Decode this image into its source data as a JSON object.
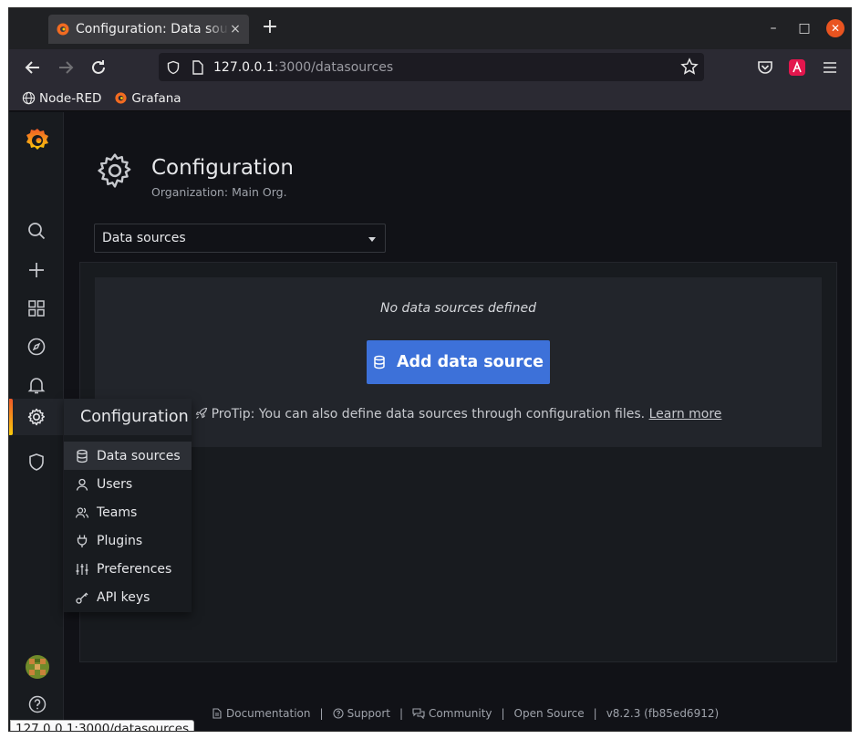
{
  "browser": {
    "tab_title": "Configuration: Data sources",
    "tab_close": "×",
    "new_tab": "+",
    "url_host": "127.0.0.1",
    "url_rest": ":3000/datasources",
    "window_min": "–",
    "window_max": "□",
    "window_close": "✕",
    "bookmarks": [
      {
        "label": "Node-RED",
        "icon": "globe-icon"
      },
      {
        "label": "Grafana",
        "icon": "grafana-icon"
      }
    ],
    "status_url": "127.0.0.1:3000/datasources"
  },
  "header": {
    "title": "Configuration",
    "subtitle": "Organization: Main Org."
  },
  "select": {
    "value": "Data sources"
  },
  "empty_state": {
    "title": "No data sources defined",
    "button": "Add data source",
    "protip": "ProTip: You can also define data sources through configuration files. ",
    "learn_more": "Learn more"
  },
  "flyout": {
    "title": "Configuration",
    "items": [
      {
        "label": "Data sources",
        "icon": "database-icon"
      },
      {
        "label": "Users",
        "icon": "user-icon"
      },
      {
        "label": "Teams",
        "icon": "users-icon"
      },
      {
        "label": "Plugins",
        "icon": "plug-icon"
      },
      {
        "label": "Preferences",
        "icon": "sliders-icon"
      },
      {
        "label": "API keys",
        "icon": "key-icon"
      }
    ]
  },
  "footer": {
    "documentation": "Documentation",
    "support": "Support",
    "community": "Community",
    "open_source": "Open Source",
    "version": "v8.2.3 (fb85ed6912)",
    "separator": "|"
  },
  "colors": {
    "accent": "#3d71d9",
    "brand_orange": "#f05a28",
    "background": "#111217",
    "panel": "#181b1f"
  }
}
